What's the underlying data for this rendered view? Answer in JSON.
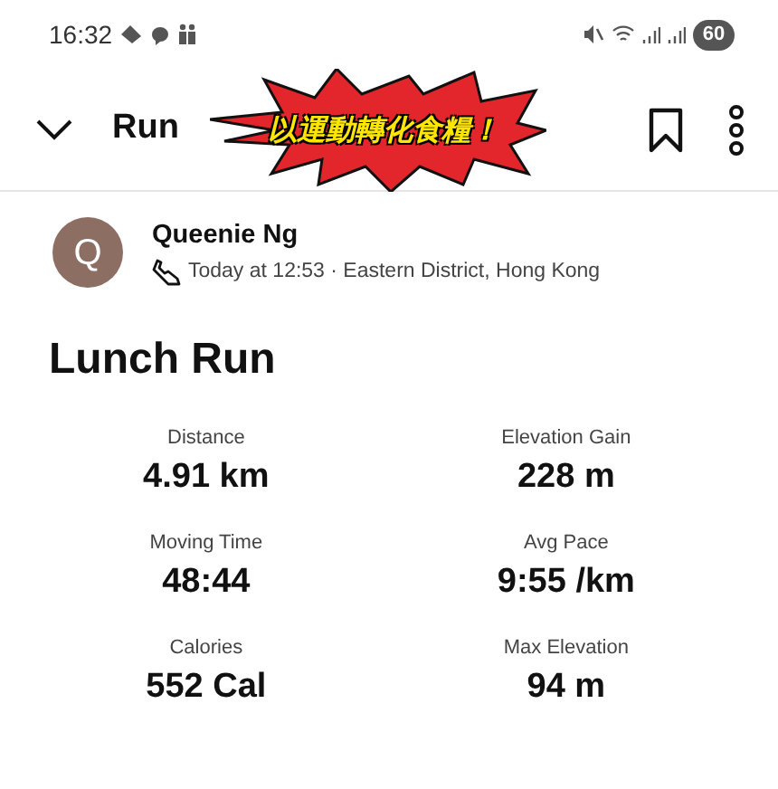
{
  "status_bar": {
    "time": "16:32",
    "battery": "60"
  },
  "toolbar": {
    "title": "Run",
    "sticker": "以運動轉化食糧！"
  },
  "athlete": {
    "initial": "Q",
    "name": "Queenie Ng",
    "meta": "Today at 12:53 · Eastern District, Hong Kong"
  },
  "activity_title": "Lunch Run",
  "stats": [
    {
      "label": "Distance",
      "value": "4.91 km"
    },
    {
      "label": "Elevation Gain",
      "value": "228 m"
    },
    {
      "label": "Moving Time",
      "value": "48:44"
    },
    {
      "label": "Avg Pace",
      "value": "9:55 /km"
    },
    {
      "label": "Calories",
      "value": "552 Cal"
    },
    {
      "label": "Max Elevation",
      "value": "94 m"
    }
  ]
}
